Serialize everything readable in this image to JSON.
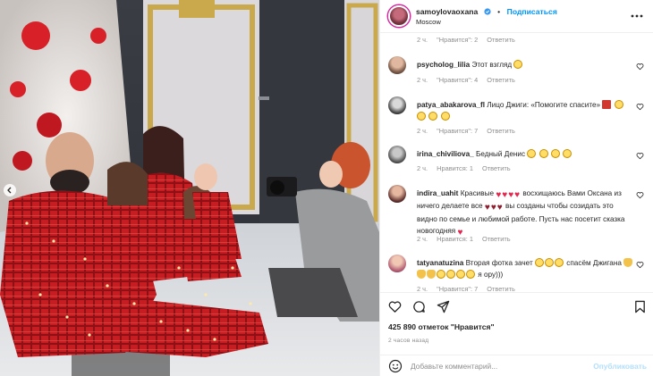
{
  "post": {
    "username": "samoylovaoxana",
    "follow_label": "Подписаться",
    "location": "Moscow",
    "likes_text": "425 890 отметок \"Нравится\"",
    "time_ago": "2 часов назад"
  },
  "comments": [
    {
      "username": "",
      "text": "",
      "meta_time": "2 ч.",
      "meta_likes": "\"Нравится\": 2",
      "meta_reply": "Ответить"
    },
    {
      "username": "psycholog_lilia",
      "text": "Этот взгляд",
      "meta_time": "2 ч.",
      "meta_likes": "\"Нравится\": 4",
      "meta_reply": "Ответить"
    },
    {
      "username": "patya_abakarova_fl",
      "text": "Лицо Джиги: «Помогите спасите»",
      "meta_time": "2 ч.",
      "meta_likes": "\"Нравится\": 7",
      "meta_reply": "Ответить"
    },
    {
      "username": "irina_chiviliova_",
      "text": "Бедный Денис",
      "meta_time": "2 ч.",
      "meta_likes": "Нравится: 1",
      "meta_reply": "Ответить"
    },
    {
      "username": "indira_uahit",
      "text_a": "Красивые",
      "text_b": "восхищаюсь Вами Оксана из ничего делаете все",
      "text_c": "вы созданы чтобы созидать это видно по семье и любимой работе. Пусть нас посетит сказка новогодняя",
      "meta_time": "2 ч.",
      "meta_likes": "Нравится: 1",
      "meta_reply": "Ответить"
    },
    {
      "username": "tatyanatuzina",
      "text_a": "Вторая фотка зачет",
      "text_b": "спасём Джигана",
      "text_c": "я ору)))",
      "meta_time": "2 ч.",
      "meta_likes": "\"Нравится\": 7",
      "meta_reply": "Ответить"
    }
  ],
  "composer": {
    "placeholder": "Добавьте комментарий...",
    "publish_label": "Опубликовать"
  },
  "icons": {
    "more": "more-icon",
    "like": "heart-icon",
    "comment": "comment-icon",
    "share": "share-icon",
    "save": "bookmark-icon",
    "emoji": "emoji-icon",
    "verified": "verified-icon",
    "prev": "chevron-left-icon"
  },
  "colors": {
    "accent": "#0095f6",
    "muted": "#8e8e8e",
    "publish_disabled": "#b2dffc"
  }
}
